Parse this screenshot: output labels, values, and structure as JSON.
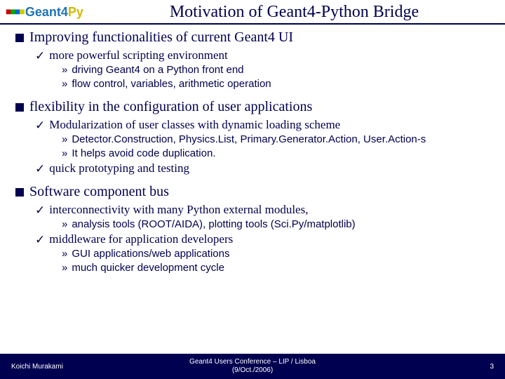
{
  "header": {
    "logo_text_part1": "Geant4",
    "logo_text_part2": "Py",
    "title": "Motivation of Geant4-Python Bridge"
  },
  "sections": [
    {
      "heading": "Improving functionalities of current Geant4 UI",
      "subs": [
        {
          "text": "more powerful scripting environment",
          "items": [
            "driving Geant4 on a Python front end",
            "flow control, variables, arithmetic operation"
          ]
        }
      ]
    },
    {
      "heading": "flexibility in the configuration of user applications",
      "subs": [
        {
          "text": "Modularization of user classes with dynamic loading scheme",
          "items": [
            "Detector.Construction, Physics.List, Primary.Generator.Action, User.Action-s",
            "It helps avoid code duplication."
          ]
        },
        {
          "text": "quick prototyping and testing",
          "items": []
        }
      ]
    },
    {
      "heading": "Software component bus",
      "subs": [
        {
          "text": "interconnectivity with many Python external modules,",
          "items": [
            " analysis tools (ROOT/AIDA), plotting tools (Sci.Py/matplotlib)"
          ]
        },
        {
          "text": "middleware for application developers",
          "items": [
            "GUI applications/web applications",
            "much quicker development cycle"
          ]
        }
      ]
    }
  ],
  "footer": {
    "author": "Koichi Murakami",
    "center_line1": "Geant4 Users Conference – LIP / Lisboa",
    "center_line2": "(9/Oct./2006)",
    "page": "3"
  }
}
